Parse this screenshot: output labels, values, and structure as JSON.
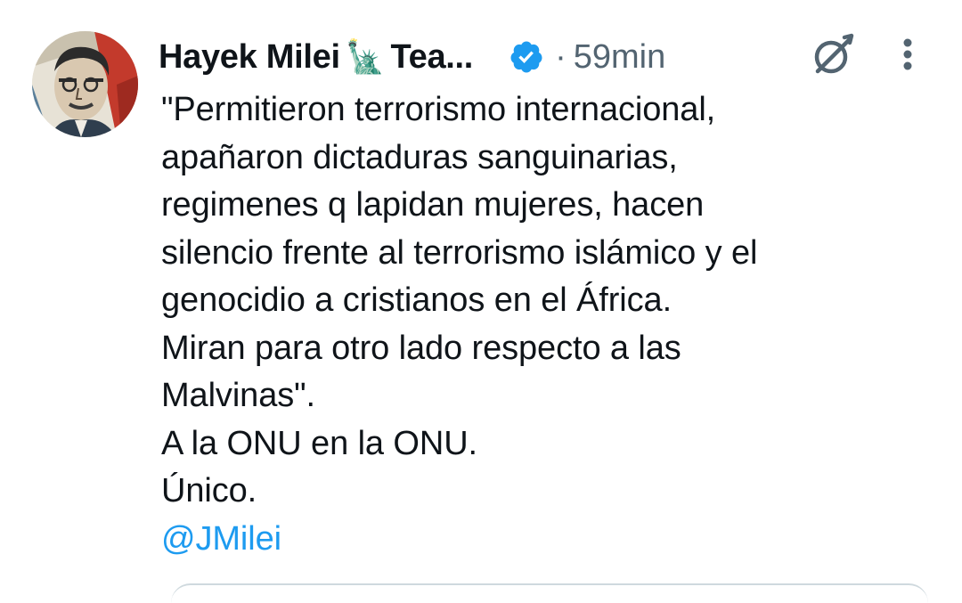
{
  "tweet": {
    "author": {
      "name_part1": "Hayek Milei",
      "name_emoji": "🗽",
      "name_part2": "Tea...",
      "verified": true,
      "avatar_icon": "avatar-portrait"
    },
    "separator": "·",
    "timestamp": "59min",
    "icons": {
      "grok": "grok-icon",
      "more": "more-icon",
      "verified": "verified-badge-icon"
    },
    "body_lines": [
      "\"Permitieron terrorismo internacional,",
      "apañaron dictaduras sanguinarias,",
      "regimenes q lapidan mujeres, hacen",
      "silencio frente al terrorismo islámico y el",
      "genocidio a cristianos en el África.",
      "Miran para otro lado respecto a las",
      "Malvinas\".",
      "A la ONU en la ONU.",
      "Único."
    ],
    "mention": "@JMilei"
  },
  "colors": {
    "text": "#0f1419",
    "secondary": "#536471",
    "link": "#1d9bf0",
    "verified": "#1d9bf0"
  }
}
